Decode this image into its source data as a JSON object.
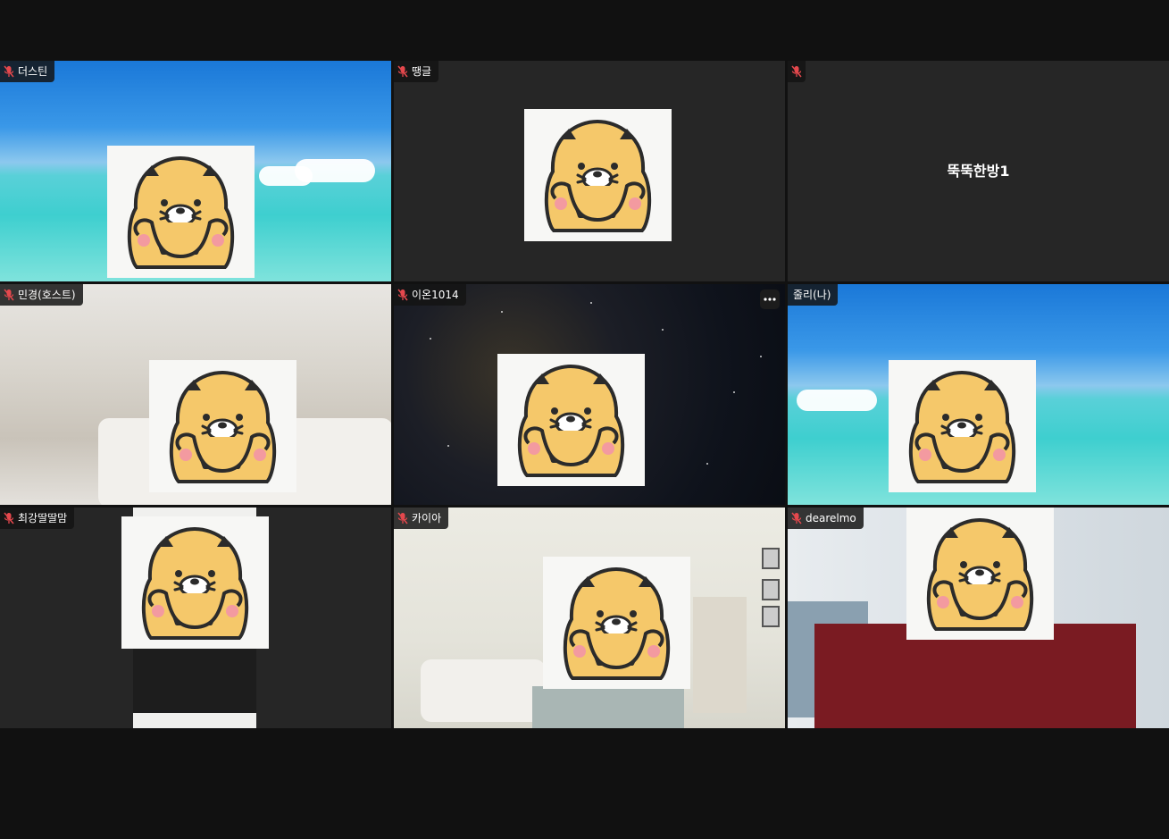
{
  "participants": [
    {
      "name": "더스틴",
      "muted": true
    },
    {
      "name": "땡글",
      "muted": true
    },
    {
      "name": "",
      "display_name": "뚝뚝한방1",
      "muted": true
    },
    {
      "name": "민경(호스트)",
      "muted": true
    },
    {
      "name": "이온1014",
      "muted": true,
      "has_more_menu": true
    },
    {
      "name": "줄리(나)",
      "muted": false
    },
    {
      "name": "최강딸딸맘",
      "muted": true
    },
    {
      "name": "카이아",
      "muted": true
    },
    {
      "name": "dearelmo",
      "muted": true
    }
  ],
  "colors": {
    "muted_mic": "#e5484d",
    "label_bg": "#141414",
    "tile_bg": "#262626",
    "avatar_yellow": "#f5c86a"
  },
  "icons": {
    "mic_muted": "mic-muted-icon",
    "more": "more-options-icon",
    "avatar": "bear-avatar-icon"
  }
}
